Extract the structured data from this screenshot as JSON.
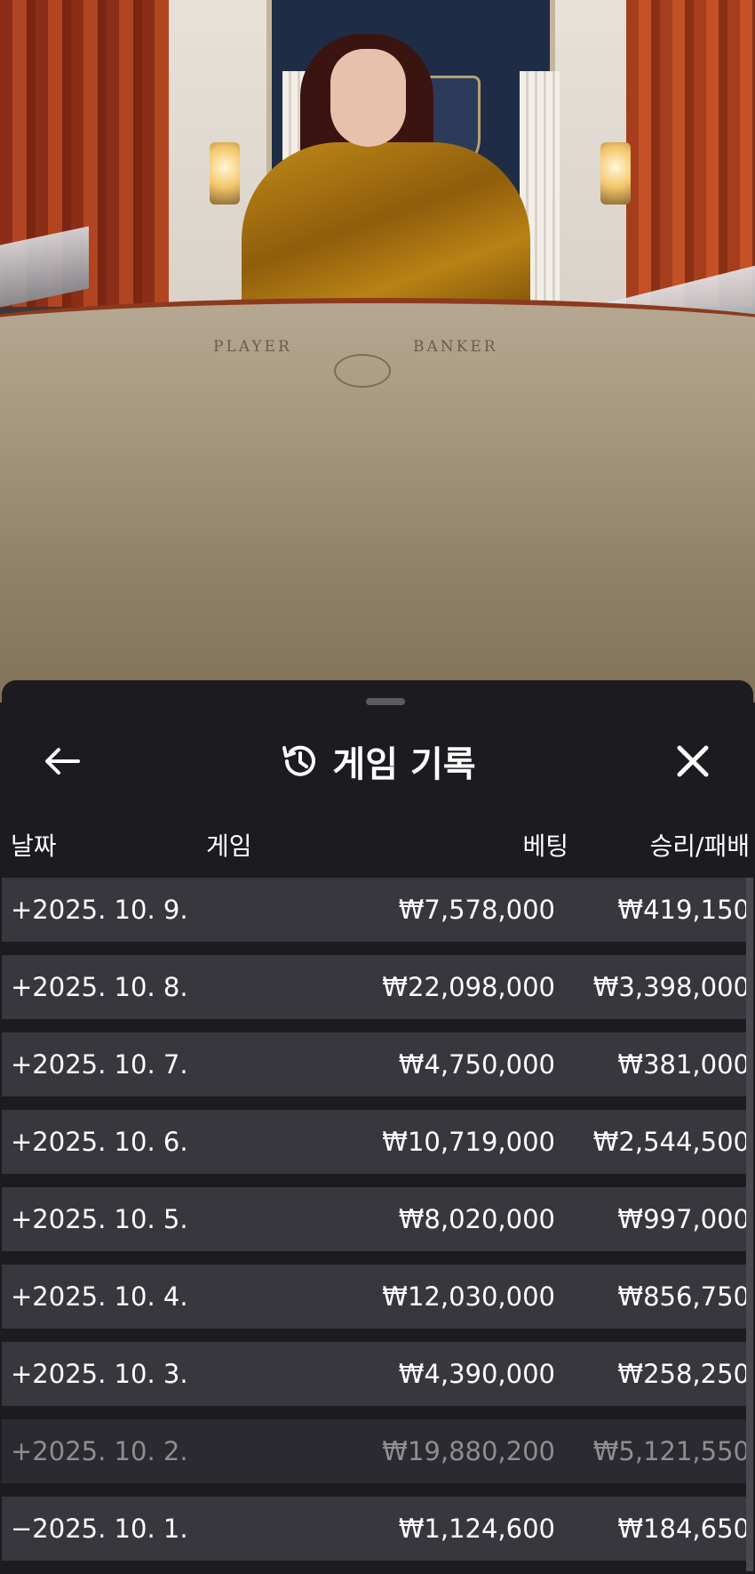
{
  "video": {
    "table_labels": [
      "PLAYER",
      "BANKER"
    ]
  },
  "sheet": {
    "title": "게임 기록",
    "back_label": "←",
    "close_label": "✕",
    "columns": {
      "date": "날짜",
      "game": "게임",
      "bet": "베팅",
      "result": "승리/패배"
    },
    "rows": [
      {
        "date": "+2025. 10. 9.",
        "bet": "₩7,578,000",
        "result": "₩419,150"
      },
      {
        "date": "+2025. 10. 8.",
        "bet": "₩22,098,000",
        "result": "₩3,398,000"
      },
      {
        "date": "+2025. 10. 7.",
        "bet": "₩4,750,000",
        "result": "₩381,000"
      },
      {
        "date": "+2025. 10. 6.",
        "bet": "₩10,719,000",
        "result": "₩2,544,500"
      },
      {
        "date": "+2025. 10. 5.",
        "bet": "₩8,020,000",
        "result": "₩997,000"
      },
      {
        "date": "+2025. 10. 4.",
        "bet": "₩12,030,000",
        "result": "₩856,750"
      },
      {
        "date": "+2025. 10. 3.",
        "bet": "₩4,390,000",
        "result": "₩258,250"
      },
      {
        "date": "+2025. 10. 2.",
        "bet": "₩19,880,200",
        "result": "₩5,121,550"
      },
      {
        "date": "−2025. 10. 1.",
        "bet": "₩1,124,600",
        "result": "₩184,650"
      }
    ]
  },
  "icons": {
    "history": "history-icon",
    "back": "arrow-left-icon",
    "close": "close-icon"
  }
}
